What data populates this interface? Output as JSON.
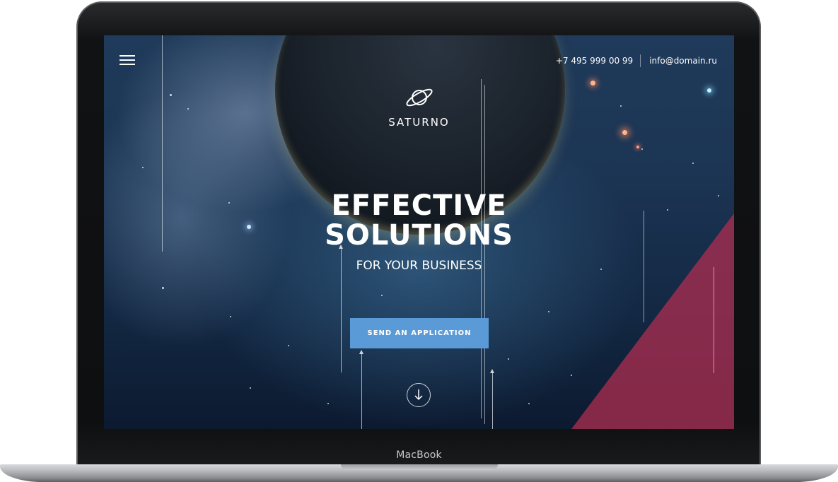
{
  "device": {
    "brand_label": "MacBook"
  },
  "site": {
    "menu_icon": "hamburger-menu-icon",
    "contacts": {
      "phone": "+7 495 999 00 99",
      "email": "info@domain.ru"
    },
    "logo": {
      "icon": "saturn-planet-icon",
      "name": "SATURNO"
    },
    "hero": {
      "title_line1": "EFFECTIVE",
      "title_line2": "SOLUTIONS",
      "subtitle": "FOR YOUR BUSINESS",
      "cta_label": "SEND AN APPLICATION",
      "scroll_icon": "arrow-down-circle-icon"
    },
    "colors": {
      "cta": "#5a9ad6",
      "accent_triangle": "#af2d50",
      "background": "#1c3554"
    }
  }
}
